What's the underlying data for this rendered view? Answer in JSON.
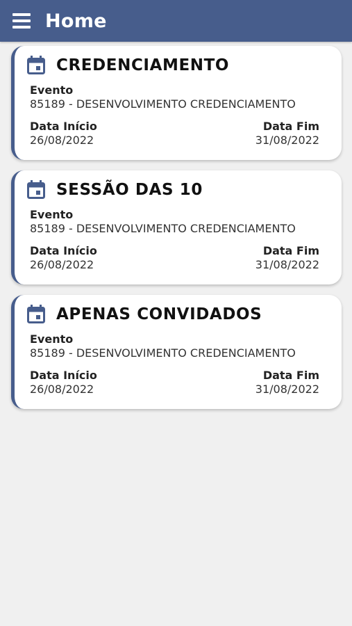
{
  "header": {
    "title": "Home",
    "menu_icon": "menu-icon",
    "background": "#475d8c"
  },
  "cards": [
    {
      "title": "CREDENCIAMENTO",
      "icon": "calendar-icon",
      "evento_label": "Evento",
      "evento_value": "85189 - DESENVOLVIMENTO CREDENCIAMENTO",
      "inicio_label": "Data Início",
      "inicio_value": "26/08/2022",
      "fim_label": "Data Fim",
      "fim_value": "31/08/2022"
    },
    {
      "title": "SESSÃO DAS 10",
      "icon": "calendar-icon",
      "evento_label": "Evento",
      "evento_value": "85189 - DESENVOLVIMENTO CREDENCIAMENTO",
      "inicio_label": "Data Início",
      "inicio_value": "26/08/2022",
      "fim_label": "Data Fim",
      "fim_value": "31/08/2022"
    },
    {
      "title": "APENAS CONVIDADOS",
      "icon": "calendar-icon",
      "evento_label": "Evento",
      "evento_value": "85189 - DESENVOLVIMENTO CREDENCIAMENTO",
      "inicio_label": "Data Início",
      "inicio_value": "26/08/2022",
      "fim_label": "Data Fim",
      "fim_value": "31/08/2022"
    }
  ],
  "colors": {
    "accent": "#475d8c",
    "background": "#f0f0f0",
    "card": "#ffffff"
  }
}
